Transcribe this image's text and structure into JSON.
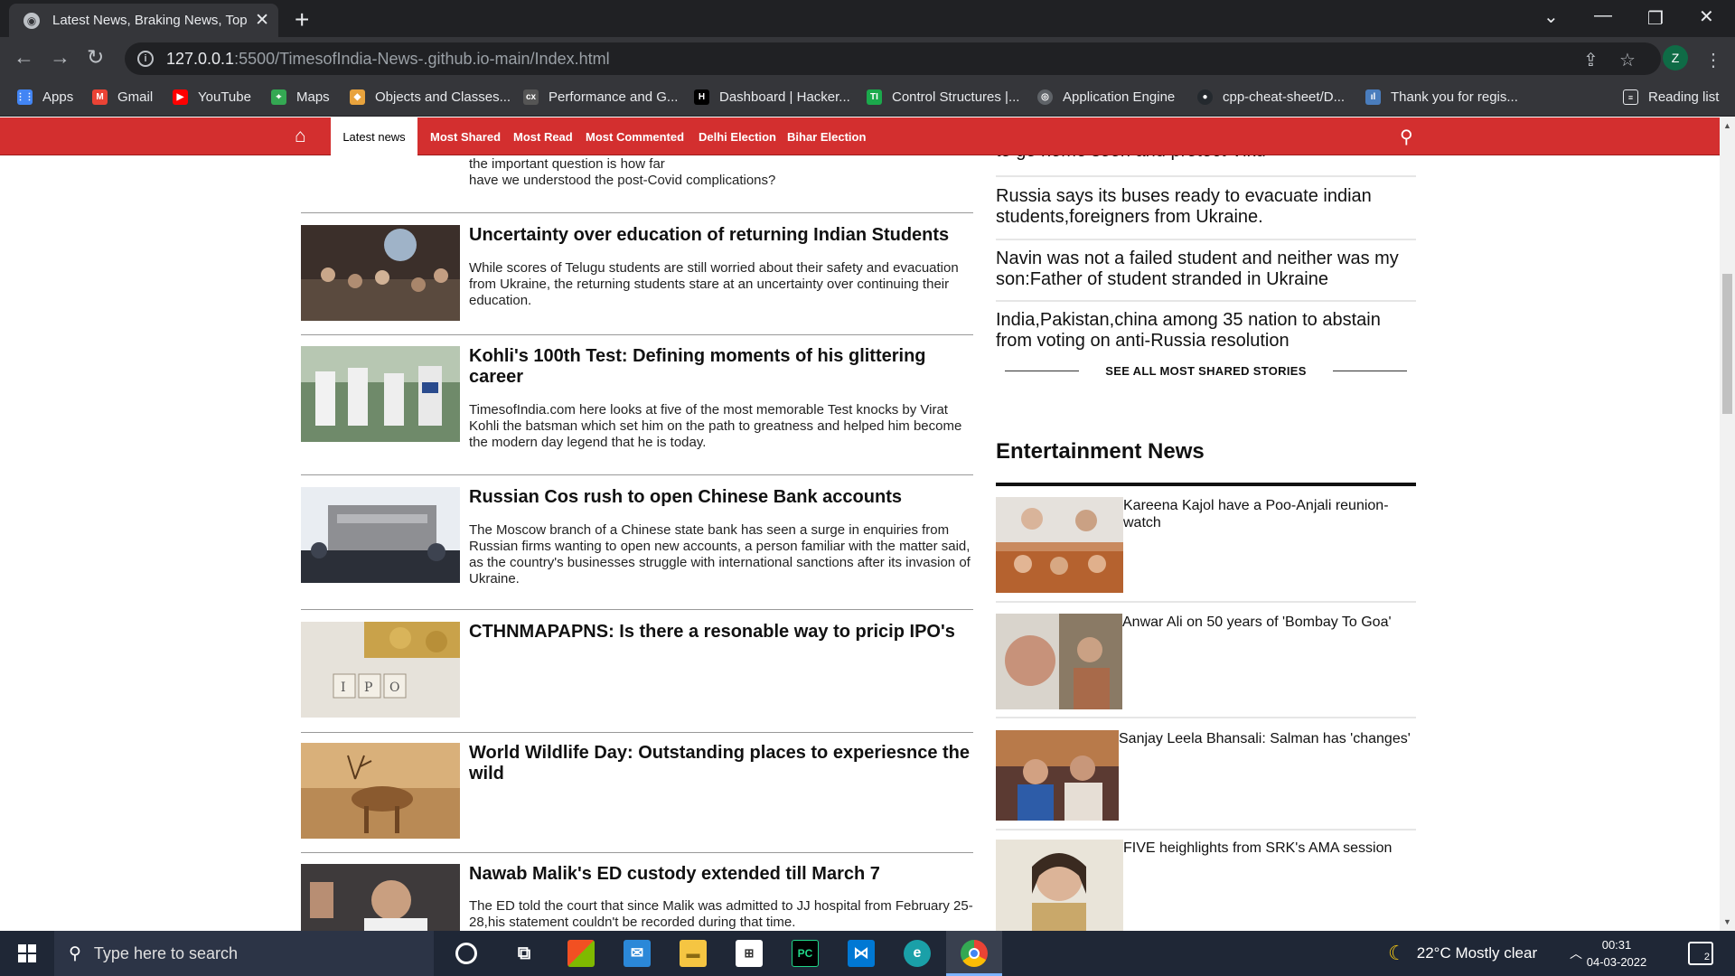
{
  "browser": {
    "tab_title": "Latest News, Braking News, Top N",
    "url_host": "127.0.0.1",
    "url_path": ":5500/TimesofIndia-News-.github.io-main/Index.html",
    "profile_initial": "Z",
    "bookmarks": [
      {
        "label": "Apps",
        "icon": "apps-grid-icon",
        "color": "#4285f4"
      },
      {
        "label": "Gmail",
        "icon": "gmail-icon",
        "color": "#ea4335"
      },
      {
        "label": "YouTube",
        "icon": "youtube-icon",
        "color": "#ff0000"
      },
      {
        "label": "Maps",
        "icon": "maps-icon",
        "color": "#34a853"
      },
      {
        "label": "Objects and Classes...",
        "icon": "page-icon",
        "color": "#e8a33d"
      },
      {
        "label": "Performance and G...",
        "icon": "page-icon",
        "color": "#555555"
      },
      {
        "label": "Dashboard | Hacker...",
        "icon": "hackerrank-icon",
        "color": "#000000"
      },
      {
        "label": "Control Structures |...",
        "icon": "page-icon",
        "color": "#1ba94c"
      },
      {
        "label": "Application Engine",
        "icon": "globe-icon",
        "color": "#5f6368"
      },
      {
        "label": "cpp-cheat-sheet/D...",
        "icon": "github-icon",
        "color": "#24292e"
      },
      {
        "label": "Thank you for regis...",
        "icon": "page-icon",
        "color": "#4a7dbd"
      }
    ],
    "reading_list": "Reading list"
  },
  "site_nav": {
    "latest": "Latest news",
    "links": [
      "Most Shared",
      "Most Read",
      "Most Commented",
      "Delhi Election",
      "Bihar Election"
    ]
  },
  "lead_tail": "the important question is how far\nhave we understood the post-Covid complications?",
  "articles": [
    {
      "headline": "Uncertainty over education of returning Indian Students",
      "summary": "While scores of Telugu students are still worried about their safety and evacuation from Ukraine, the returning students stare at an uncertainty over continuing their education."
    },
    {
      "headline": "Kohli's 100th Test: Defining moments of his glittering career",
      "summary": "TimesofIndia.com here looks at five of the most memorable Test knocks by Virat Kohli the batsman which set him on the path to greatness and helped him become the modern day legend that he is today."
    },
    {
      "headline": "Russian Cos rush to open Chinese Bank accounts",
      "summary": "The Moscow branch of a Chinese state bank has seen a surge in enquiries from Russian firms wanting to open new accounts, a person familiar with the matter said, as the country's businesses struggle with international sanctions after its invasion of Ukraine."
    },
    {
      "headline": "CTHNMAPAPNS: Is there a resonable way to pricip IPO's",
      "summary": ""
    },
    {
      "headline": "World Wildlife Day: Outstanding places to experiesnce the wild",
      "summary": ""
    },
    {
      "headline": "Nawab Malik's ED custody extended till March 7",
      "summary": "The ED told the court that since Malik was admitted to JJ hospital from February 25-28,his statement couldn't be recorded during that time."
    }
  ],
  "most_shared": {
    "partial_item": "to go home soon and protect Viku",
    "items": [
      "Russia says its buses ready to evacuate indian students,foreigners from Ukraine.",
      "Navin was not a failed student and neither was my son:Father of student stranded in Ukraine",
      "India,Pakistan,china among 35 nation to abstain from voting on anti-Russia resolution"
    ],
    "see_all": "SEE ALL MOST SHARED STORIES"
  },
  "entertainment": {
    "title": "Entertainment News",
    "items": [
      "Kareena Kajol have a Poo-Anjali reunion-watch",
      "Anwar Ali on 50 years of 'Bombay To Goa'",
      "Sanjay Leela Bhansali: Salman has 'changes'",
      "FIVE heighlights from SRK's AMA session"
    ]
  },
  "taskbar": {
    "search_placeholder": "Type here to search",
    "weather": "22°C  Mostly clear",
    "time": "00:31",
    "date": "04-03-2022",
    "notifications": "2"
  },
  "colors": {
    "brand_red": "#d32f2f",
    "chrome_dark": "#202124",
    "chrome_toolbar": "#35363a",
    "taskbar": "#1f2736"
  }
}
